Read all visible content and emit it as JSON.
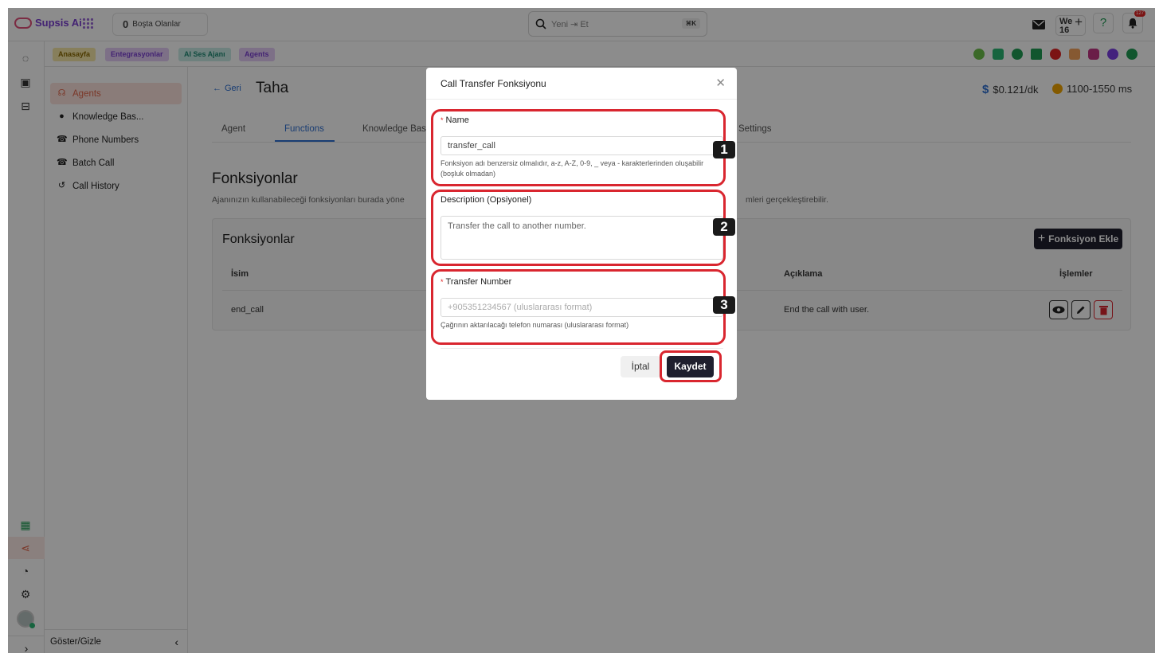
{
  "topbar": {
    "brand": "Supsis Ai",
    "idle_count": "0",
    "idle_label": "Boşta Olanlar",
    "search_placeholder": "Yeni ⇥ Et",
    "search_shortcut": "⌘K",
    "we_label": "We",
    "we_count": "16",
    "notification_count": "127"
  },
  "crumbs": [
    {
      "label": "Anasayfa",
      "bg": "#f6e7a8",
      "fg": "#8a6a00"
    },
    {
      "label": "Entegrasyonlar",
      "bg": "#e4cdf6",
      "fg": "#7a3fd1"
    },
    {
      "label": "AI Ses Ajanı",
      "bg": "#c9ece6",
      "fg": "#1f8a75"
    },
    {
      "label": "Agents",
      "bg": "#e4cdf6",
      "fg": "#7a3fd1"
    }
  ],
  "sidebar": {
    "items": [
      {
        "label": "Agents",
        "icon": "headset-icon"
      },
      {
        "label": "Knowledge Bas...",
        "icon": "bulb-icon"
      },
      {
        "label": "Phone Numbers",
        "icon": "phone-icon"
      },
      {
        "label": "Batch Call",
        "icon": "phone-icon"
      },
      {
        "label": "Call History",
        "icon": "history-icon"
      }
    ],
    "toggle_label": "Göster/Gizle"
  },
  "main": {
    "back_label": "Geri",
    "agent_name": "Taha",
    "price": "$0.121/dk",
    "latency": "1100-1550 ms",
    "tabs": [
      "Agent",
      "Functions",
      "Knowledge Bas",
      "Settings"
    ],
    "active_tab": "Functions",
    "page_title": "Fonksiyonlar",
    "page_desc": "Ajanınızın kullanabileceği fonksiyonları burada yöne",
    "page_desc_tail": "mleri gerçekleştirebilir.",
    "card_title": "Fonksiyonlar",
    "add_button": "Fonksiyon Ekle",
    "columns": [
      "İsim",
      "Açıklama",
      "İşlemler"
    ],
    "rows": [
      {
        "name": "end_call",
        "description": "End the call with user."
      }
    ]
  },
  "modal": {
    "title": "Call Transfer Fonksiyonu",
    "name_label": "Name",
    "name_value": "transfer_call",
    "name_help": "Fonksiyon adı benzersiz olmalıdır, a-z, A-Z, 0-9, _ veya - karakterlerinden oluşabilir (boşluk olmadan)",
    "desc_label": "Description (Opsiyonel)",
    "desc_value": "Transfer the call to another number.",
    "transfer_label": "Transfer Number",
    "transfer_placeholder": "+905351234567 (uluslararası format)",
    "transfer_help": "Çağrının aktarılacağı telefon numarası (uluslararası format)",
    "cancel_label": "İptal",
    "save_label": "Kaydet"
  },
  "annotations": [
    "1",
    "2",
    "3"
  ],
  "colors": {
    "accent": "#2f6fd1",
    "highlight": "#d9262f",
    "primary_button": "#1f1f2e",
    "active_item": "#e0654a"
  }
}
